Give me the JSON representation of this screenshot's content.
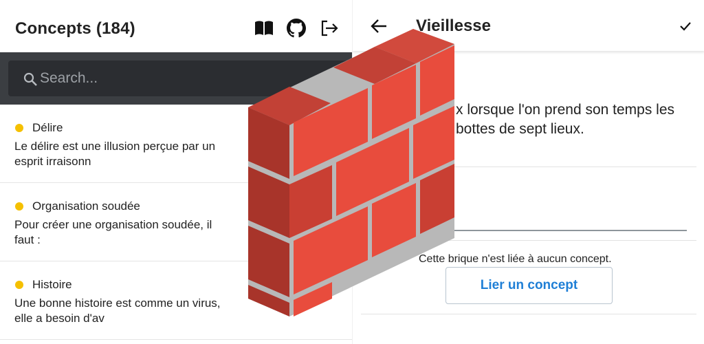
{
  "left_panel": {
    "title": "Concepts (184)",
    "header_icons": [
      "book-icon",
      "github-icon",
      "logout-icon"
    ],
    "search": {
      "placeholder": "Search..."
    },
    "concepts": [
      {
        "title": "Délire",
        "description": "Le délire est une illusion perçue par un esprit irraisonn"
      },
      {
        "title": "Organisation soudée",
        "description": "Pour créer une organisation soudée, il faut :"
      },
      {
        "title": "Histoire",
        "description": "Une bonne histoire est comme un virus, elle a besoin d'av"
      }
    ]
  },
  "right_panel": {
    "title": "Vieillesse",
    "content": "x lorsque l'on prend son temps les bottes de sept lieux.",
    "no_concept_text": "Cette brique n'est liée à aucun concept.",
    "link_button_label": "Lier un concept",
    "header_icons": [
      "back-arrow-icon",
      "check-icon"
    ]
  },
  "colors": {
    "dot": "#f5c000",
    "search_bar_bg": "#3b3e42",
    "link_blue": "#1f7fd6",
    "brick_red": "#e84c3d",
    "brick_dark": "#a8342a",
    "mortar": "#bdbdbd"
  },
  "logo": "brick-wall-logo"
}
